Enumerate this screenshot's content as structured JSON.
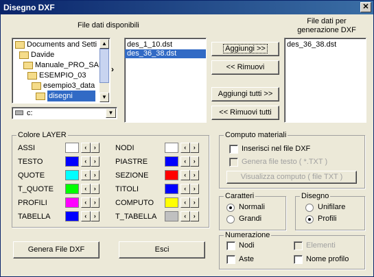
{
  "window": {
    "title": "Disegno DXF",
    "close_glyph": "✕"
  },
  "available": {
    "header": "File dati  disponibili",
    "tree": [
      "Documents and Setti",
      "Davide",
      "Manuale_PRO_SAF",
      "ESEMPIO_03",
      "esempio3_data",
      "disegni"
    ],
    "drive": "c:",
    "files": [
      "des_1_10.dst",
      "des_36_38.dst"
    ],
    "selected_index": 1
  },
  "target": {
    "header_line1": "File dati per",
    "header_line2": "generazione DXF",
    "files": [
      "des_36_38.dst"
    ]
  },
  "buttons": {
    "add": "Aggiungi >>",
    "remove": "<< Rimuovi",
    "add_all": "Aggiungi tutti >>",
    "remove_all": "<< Rimuovi tutti",
    "generate": "Genera File DXF",
    "exit": "Esci"
  },
  "colore": {
    "title": "Colore LAYER",
    "left": [
      {
        "name": "ASSI",
        "color": "#ffffff"
      },
      {
        "name": "TESTO",
        "color": "#0000ff"
      },
      {
        "name": "QUOTE",
        "color": "#00ffff"
      },
      {
        "name": "T_QUOTE",
        "color": "#00ff00"
      },
      {
        "name": "PROFILI",
        "color": "#ff00ff"
      },
      {
        "name": "TABELLA",
        "color": "#0000ff"
      }
    ],
    "right": [
      {
        "name": "NODI",
        "color": "#ffffff"
      },
      {
        "name": "PIASTRE",
        "color": "#0000ff"
      },
      {
        "name": "SEZIONE",
        "color": "#ff0000"
      },
      {
        "name": "TITOLI",
        "color": "#0000ff"
      },
      {
        "name": "COMPUTO",
        "color": "#ffff00"
      },
      {
        "name": "T_TABELLA",
        "color": "#c0c0c0"
      }
    ]
  },
  "computo": {
    "title": "Computo materiali",
    "insert": "Inserisci nel file DXF",
    "gen_text": "Genera file testo  ( *.TXT )",
    "view": "Visualizza computo ( file TXT )"
  },
  "caratteri": {
    "title": "Caratteri",
    "normal": "Normali",
    "large": "Grandi",
    "selected": "Normali"
  },
  "disegno": {
    "title": "Disegno",
    "unifilar": "Unifilare",
    "profiles": "Profili",
    "selected": "Profili"
  },
  "numerazione": {
    "title": "Numerazione",
    "nodes": "Nodi",
    "elements": "Elementi",
    "rods": "Aste",
    "profile_name": "Nome profilo"
  }
}
